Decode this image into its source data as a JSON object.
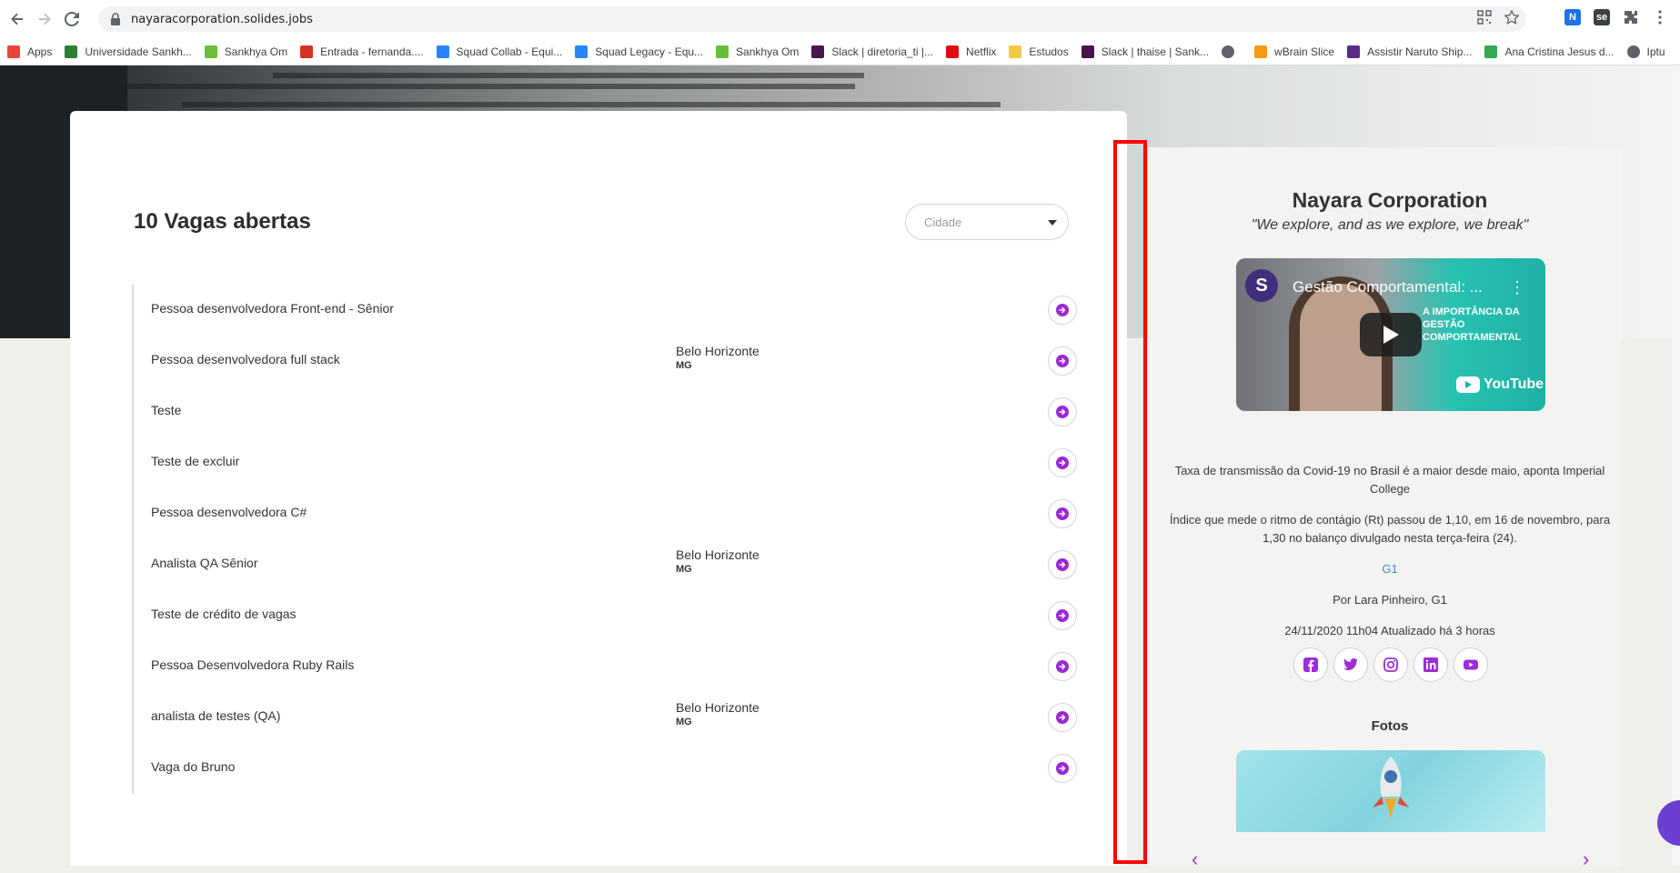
{
  "browser": {
    "url": "nayaracorporation.solides.jobs",
    "bookmarks": [
      {
        "label": "Apps",
        "icon": "apps-grid-icon",
        "color": "#e8453c"
      },
      {
        "label": "Universidade Sankh...",
        "icon": "sankhya-leaf-icon",
        "color": "#2e7d32"
      },
      {
        "label": "Sankhya Om",
        "icon": "sankhya-leaf-icon",
        "color": "#6abf3a"
      },
      {
        "label": "Entrada - fernanda....",
        "icon": "gmail-icon",
        "color": "#d93025"
      },
      {
        "label": "Squad Collab - Equi...",
        "icon": "jira-diamond-icon",
        "color": "#2684ff"
      },
      {
        "label": "Squad Legacy - Equ...",
        "icon": "jira-diamond-icon",
        "color": "#2684ff"
      },
      {
        "label": "Sankhya Om",
        "icon": "sankhya-leaf-icon",
        "color": "#6abf3a"
      },
      {
        "label": "Slack | diretoria_ti |...",
        "icon": "slack-icon",
        "color": "#4a154b"
      },
      {
        "label": "Netflix",
        "icon": "netflix-icon",
        "color": "#e50914"
      },
      {
        "label": "Estudos",
        "icon": "folder-icon",
        "color": "#f6c645"
      },
      {
        "label": "Slack | thaise | Sank...",
        "icon": "slack-icon",
        "color": "#4a154b"
      },
      {
        "label": "",
        "icon": "globe-icon",
        "color": "#5f6368"
      },
      {
        "label": "wBrain Slice",
        "icon": "wbrain-icon",
        "color": "#f39c12"
      },
      {
        "label": "Assistir Naruto Ship...",
        "icon": "naruto-m-icon",
        "color": "#5b2c83"
      },
      {
        "label": "Ana Cristina Jesus d...",
        "icon": "puzzle-green-icon",
        "color": "#34a853"
      },
      {
        "label": "Iptu",
        "icon": "globe-icon",
        "color": "#5f6368"
      }
    ]
  },
  "jobs": {
    "title": "10 Vagas abertas",
    "city_placeholder": "Cidade",
    "items": [
      {
        "title": "Pessoa desenvolvedora Front-end - Sênior",
        "city": "",
        "uf": ""
      },
      {
        "title": "Pessoa desenvolvedora full stack",
        "city": "Belo Horizonte",
        "uf": "MG"
      },
      {
        "title": "Teste",
        "city": "",
        "uf": ""
      },
      {
        "title": "Teste de excluir",
        "city": "",
        "uf": ""
      },
      {
        "title": "Pessoa desenvolvedora C#",
        "city": "",
        "uf": ""
      },
      {
        "title": "Analista QA Sênior",
        "city": "Belo Horizonte",
        "uf": "MG"
      },
      {
        "title": "Teste de crédito de vagas",
        "city": "",
        "uf": ""
      },
      {
        "title": "Pessoa Desenvolvedora Ruby Rails",
        "city": "",
        "uf": ""
      },
      {
        "title": "analista de testes (QA)",
        "city": "Belo Horizonte",
        "uf": "MG"
      },
      {
        "title": "Vaga do Bruno",
        "city": "",
        "uf": ""
      }
    ]
  },
  "company": {
    "name": "Nayara Corporation",
    "tagline": "\"We explore, and as we explore, we break\"",
    "video": {
      "title": "Gestão Comportamental: ...",
      "logo_letter": "S",
      "overlay": "A IMPORTÂNCIA DA GESTÃO COMPORTAMENTAL",
      "brand": "YouTube"
    },
    "news": {
      "headline": "Taxa de transmissão da Covid-19 no Brasil é a maior desde maio, aponta Imperial College",
      "body": "Índice que mede o ritmo de contágio (Rt) passou de 1,10, em 16 de novembro, para 1,30 no balanço divulgado nesta terça-feira (24).",
      "source_link": "G1",
      "author": "Por Lara Pinheiro, G1",
      "timestamp": "24/11/2020 11h04 Atualizado há 3 horas"
    },
    "socials": [
      "facebook-icon",
      "twitter-icon",
      "instagram-icon",
      "linkedin-icon",
      "youtube-icon"
    ],
    "photos_title": "Fotos"
  },
  "colors": {
    "accent": "#9b27d6",
    "highlight": "#ff0000",
    "link": "#3b86e5"
  }
}
